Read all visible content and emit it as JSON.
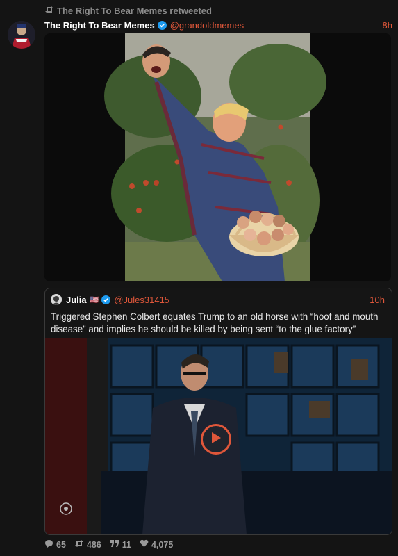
{
  "retweet": {
    "text": "The Right To Bear Memes retweeted"
  },
  "tweet": {
    "name": "The Right To Bear Memes",
    "handle": "@grandoldmemes",
    "time": "8h"
  },
  "quote": {
    "name": "Julia",
    "flag": "🇺🇸",
    "handle": "@Jules31415",
    "time": "10h",
    "text": "Triggered Stephen Colbert equates Trump to an old horse with “hoof and mouth disease” and implies he should be killed by being sent “to the glue factory”"
  },
  "stats": {
    "replies": "65",
    "retweets": "486",
    "quotes": "11",
    "likes": "4,075"
  },
  "colors": {
    "accent": "#e0573a",
    "verified": "#1d9bf0",
    "background": "#141414",
    "muted": "#8a8a8a"
  },
  "icons": [
    "retweet-icon",
    "verified-icon",
    "play-icon",
    "reply-icon",
    "quote-icon",
    "heart-icon"
  ]
}
